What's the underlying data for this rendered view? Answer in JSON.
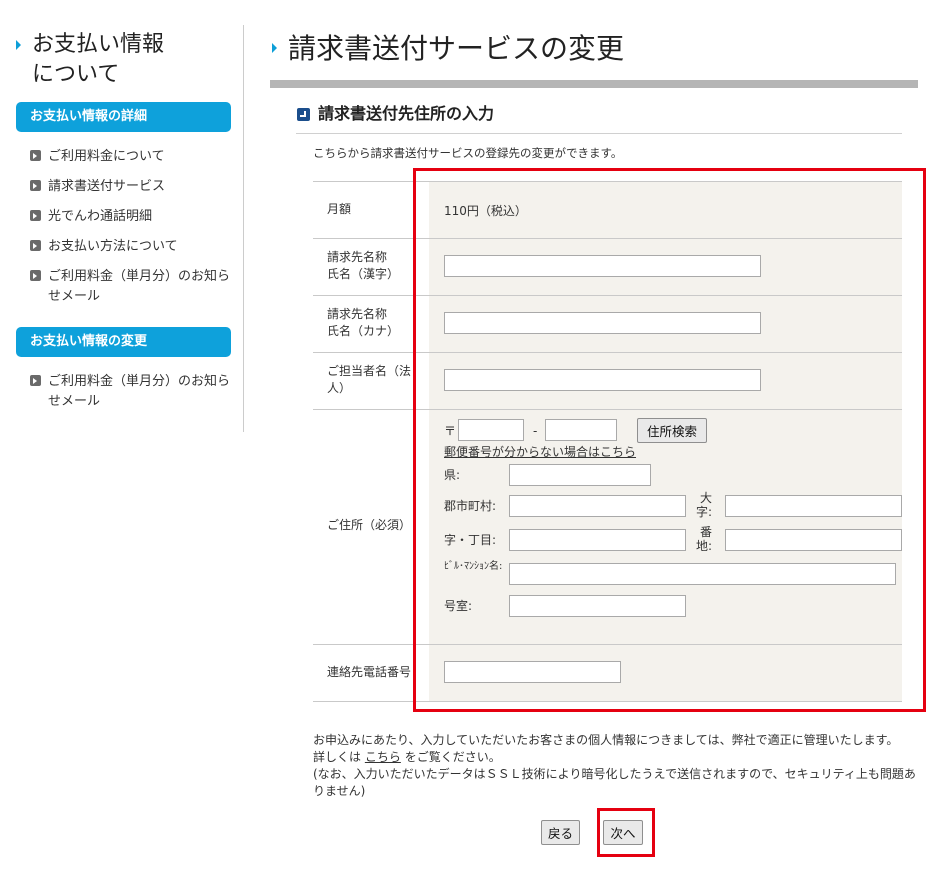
{
  "colors": {
    "accent": "#0ea1db",
    "highlight": "#e50010",
    "form_bg": "#f4f2ed",
    "title_bar": "#b5b5b5"
  },
  "sidebar": {
    "title": "お支払い情報\nについて",
    "section1": {
      "heading": "お支払い情報の詳細",
      "items": [
        {
          "label": "ご利用料金について"
        },
        {
          "label": "請求書送付サービス"
        },
        {
          "label": "光でんわ通話明細"
        },
        {
          "label": "お支払い方法について"
        },
        {
          "label": "ご利用料金（単月分）のお知らせメール"
        }
      ]
    },
    "section2": {
      "heading": "お支払い情報の変更",
      "items": [
        {
          "label": "ご利用料金（単月分）のお知らせメール"
        }
      ]
    },
    "bullet_icon": "arrow-bullet-icon"
  },
  "main": {
    "page_title": "請求書送付サービスの変更",
    "section_title": "請求書送付先住所の入力",
    "intro": "こちらから請求書送付サービスの登録先の変更ができます。",
    "form": {
      "monthly": {
        "label": "月額",
        "value": "110円（税込）"
      },
      "name_kanji": {
        "label": "請求先名称\n氏名（漢字）",
        "value": ""
      },
      "name_kana": {
        "label": "請求先名称\n氏名（カナ）",
        "value": ""
      },
      "contact_person": {
        "label": "ご担当者名（法人）",
        "value": ""
      },
      "address": {
        "label": "ご住所（必須）",
        "postal_mark": "〒",
        "postal_sep": "-",
        "postal1": "",
        "postal2": "",
        "search_button": "住所検索",
        "unknown_link": "郵便番号が分からない場合はこちら",
        "prefecture_label": "県:",
        "city_label": "郡市町村:",
        "oaza_label": "大字:",
        "aza_label": "字・丁目:",
        "banchi_label": "番地:",
        "building_label": "ﾋﾞﾙ･ﾏﾝｼｮﾝ名:",
        "room_label": "号室:"
      },
      "phone": {
        "label": "連絡先電話番号",
        "value": ""
      }
    },
    "notes": {
      "line1": "お申込みにあたり、入力していただいたお客さまの個人情報につきましては、弊社で適正に管理いたします。",
      "line2_prefix": "詳しくは",
      "line2_link": "こちら",
      "line2_suffix": "をご覧ください。",
      "line3": "(なお、入力いただいたデータはＳＳＬ技術により暗号化したうえで送信されますので、セキュリティ上も問題あ",
      "line4": "りません)"
    },
    "buttons": {
      "back": "戻る",
      "next": "次へ"
    }
  }
}
